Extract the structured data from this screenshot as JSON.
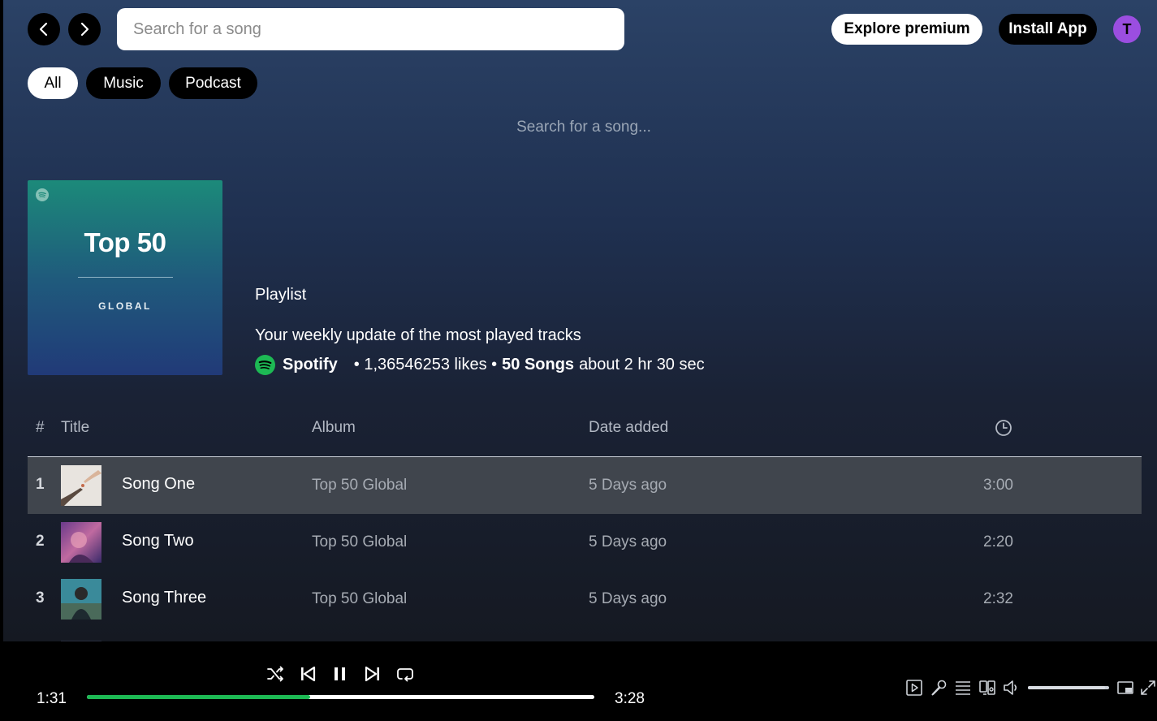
{
  "header": {
    "search_placeholder": "Search for a song",
    "explore_label": "Explore premium",
    "install_label": "Install App",
    "avatar_initial": "T"
  },
  "filters": [
    {
      "label": "All",
      "active": true
    },
    {
      "label": "Music",
      "active": false
    },
    {
      "label": "Podcast",
      "active": false
    }
  ],
  "search_hint": "Search for a song...",
  "playlist": {
    "cover_title": "Top 50",
    "cover_subtitle": "GLOBAL",
    "type": "Playlist",
    "description": "Your weekly update of the most played tracks",
    "owner": "Spotify",
    "likes": "• 1,36546253 likes •",
    "song_count": "50 Songs",
    "duration": "about 2 hr 30 sec"
  },
  "table": {
    "headers": {
      "num": "#",
      "title": "Title",
      "album": "Album",
      "date": "Date added",
      "duration_icon": "clock-icon"
    },
    "rows": [
      {
        "num": "1",
        "title": "Song One",
        "album": "Top 50 Global",
        "date": "5 Days ago",
        "duration": "3:00",
        "highlighted": true
      },
      {
        "num": "2",
        "title": "Song Two",
        "album": "Top 50 Global",
        "date": "5 Days ago",
        "duration": "2:20",
        "highlighted": false
      },
      {
        "num": "3",
        "title": "Song Three",
        "album": "Top 50 Global",
        "date": "5 Days ago",
        "duration": "2:32",
        "highlighted": false
      }
    ]
  },
  "player": {
    "current_time": "1:31",
    "total_time": "3:28",
    "progress_fraction": 0.44,
    "volume_fraction": 0.95,
    "controls": [
      "shuffle-icon",
      "previous-icon",
      "pause-icon",
      "next-icon",
      "repeat-icon"
    ],
    "right_icons": [
      "now-playing-icon",
      "lyrics-icon",
      "queue-icon",
      "connect-device-icon",
      "volume-icon",
      "mini-player-icon",
      "fullscreen-icon"
    ]
  },
  "colors": {
    "accent": "#1db954",
    "avatar": "#9b4ee0",
    "highlight_row": "#40454d"
  }
}
